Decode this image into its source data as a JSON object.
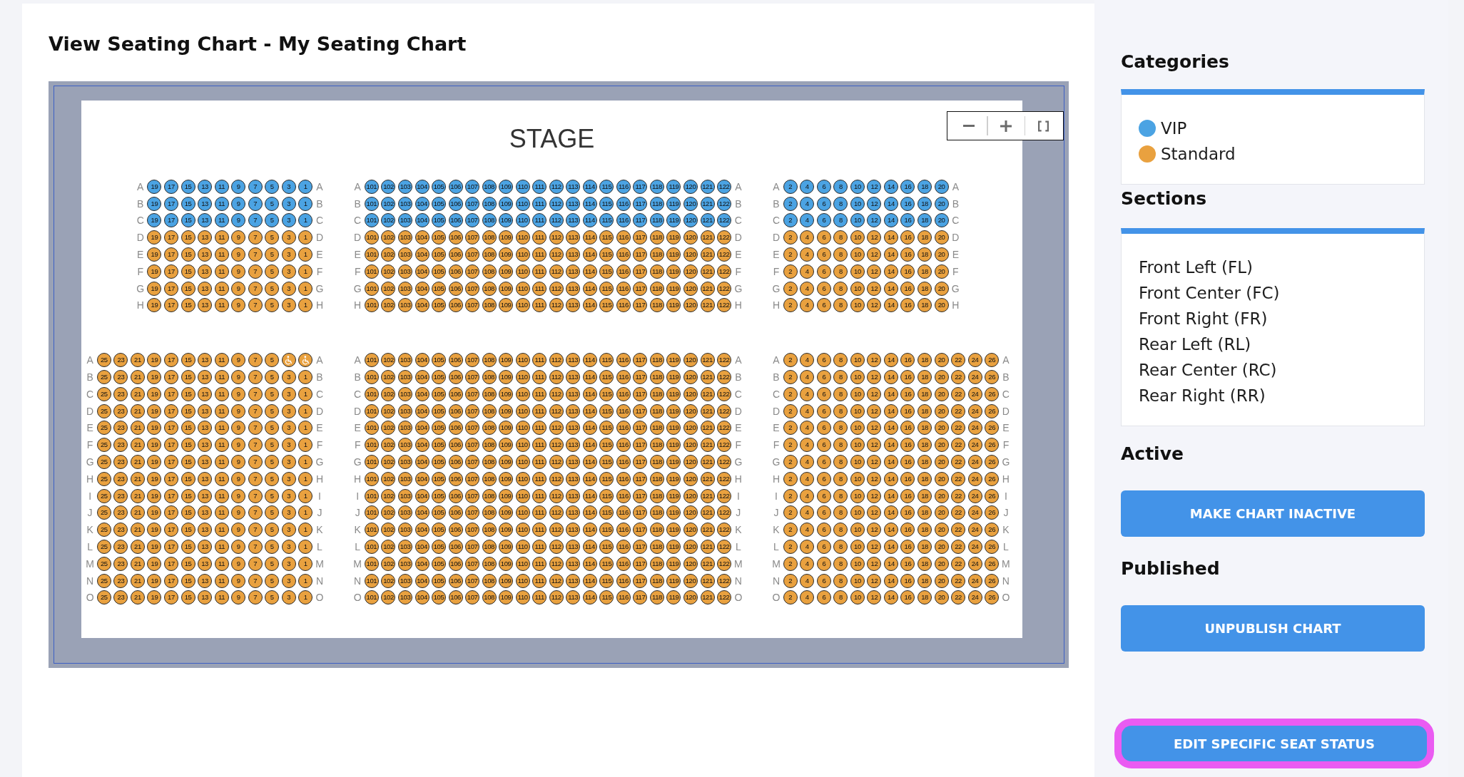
{
  "page": {
    "title": "View Seating Chart - My Seating Chart"
  },
  "chart": {
    "stage_label": "STAGE",
    "zoom_controls": [
      {
        "kind": "zoom_out"
      },
      {
        "kind": "zoom_in"
      },
      {
        "kind": "fit"
      }
    ],
    "blocks": [
      {
        "sections": [
          {
            "rows": [
              {
                "label": "A",
                "end_label": "A",
                "color": "#4ba3e3",
                "seats": [
                  "19",
                  "17",
                  "15",
                  "13",
                  "11",
                  "9",
                  "7",
                  "5",
                  "3",
                  "1"
                ]
              },
              {
                "label": "B",
                "end_label": "B",
                "color": "#4ba3e3",
                "seats": [
                  "19",
                  "17",
                  "15",
                  "13",
                  "11",
                  "9",
                  "7",
                  "5",
                  "3",
                  "1"
                ]
              },
              {
                "label": "C",
                "end_label": "C",
                "color": "#4ba3e3",
                "seats": [
                  "19",
                  "17",
                  "15",
                  "13",
                  "11",
                  "9",
                  "7",
                  "5",
                  "3",
                  "1"
                ]
              },
              {
                "label": "D",
                "end_label": "D",
                "color": "#e9a13f",
                "seats": [
                  "19",
                  "17",
                  "15",
                  "13",
                  "11",
                  "9",
                  "7",
                  "5",
                  "3",
                  "1"
                ]
              },
              {
                "label": "E",
                "end_label": "E",
                "color": "#e9a13f",
                "seats": [
                  "19",
                  "17",
                  "15",
                  "13",
                  "11",
                  "9",
                  "7",
                  "5",
                  "3",
                  "1"
                ]
              },
              {
                "label": "F",
                "end_label": "F",
                "color": "#e9a13f",
                "seats": [
                  "19",
                  "17",
                  "15",
                  "13",
                  "11",
                  "9",
                  "7",
                  "5",
                  "3",
                  "1"
                ]
              },
              {
                "label": "G",
                "end_label": "G",
                "color": "#e9a13f",
                "seats": [
                  "19",
                  "17",
                  "15",
                  "13",
                  "11",
                  "9",
                  "7",
                  "5",
                  "3",
                  "1"
                ]
              },
              {
                "label": "H",
                "end_label": "H",
                "color": "#e9a13f",
                "seats": [
                  "19",
                  "17",
                  "15",
                  "13",
                  "11",
                  "9",
                  "7",
                  "5",
                  "3",
                  "1"
                ]
              }
            ]
          },
          {
            "rows": [
              {
                "label": "A",
                "end_label": "A",
                "color": "#4ba3e3",
                "seats": [
                  "101",
                  "102",
                  "103",
                  "104",
                  "105",
                  "106",
                  "107",
                  "108",
                  "109",
                  "110",
                  "111",
                  "112",
                  "113",
                  "114",
                  "115",
                  "116",
                  "117",
                  "118",
                  "119",
                  "120",
                  "121",
                  "122"
                ]
              },
              {
                "label": "B",
                "end_label": "B",
                "color": "#4ba3e3",
                "seats": [
                  "101",
                  "102",
                  "103",
                  "104",
                  "105",
                  "106",
                  "107",
                  "108",
                  "109",
                  "110",
                  "111",
                  "112",
                  "113",
                  "114",
                  "115",
                  "116",
                  "117",
                  "118",
                  "119",
                  "120",
                  "121",
                  "122"
                ]
              },
              {
                "label": "C",
                "end_label": "C",
                "color": "#4ba3e3",
                "seats": [
                  "101",
                  "102",
                  "103",
                  "104",
                  "105",
                  "106",
                  "107",
                  "108",
                  "109",
                  "110",
                  "111",
                  "112",
                  "113",
                  "114",
                  "115",
                  "116",
                  "117",
                  "118",
                  "119",
                  "120",
                  "121",
                  "122"
                ]
              },
              {
                "label": "D",
                "end_label": "D",
                "color": "#e9a13f",
                "seats": [
                  "101",
                  "102",
                  "103",
                  "104",
                  "105",
                  "106",
                  "107",
                  "108",
                  "109",
                  "110",
                  "111",
                  "112",
                  "113",
                  "114",
                  "115",
                  "116",
                  "117",
                  "118",
                  "119",
                  "120",
                  "121",
                  "122"
                ]
              },
              {
                "label": "E",
                "end_label": "E",
                "color": "#e9a13f",
                "seats": [
                  "101",
                  "102",
                  "103",
                  "104",
                  "105",
                  "106",
                  "107",
                  "108",
                  "109",
                  "110",
                  "111",
                  "112",
                  "113",
                  "114",
                  "115",
                  "116",
                  "117",
                  "118",
                  "119",
                  "120",
                  "121",
                  "122"
                ]
              },
              {
                "label": "F",
                "end_label": "F",
                "color": "#e9a13f",
                "seats": [
                  "101",
                  "102",
                  "103",
                  "104",
                  "105",
                  "106",
                  "107",
                  "108",
                  "109",
                  "110",
                  "111",
                  "112",
                  "113",
                  "114",
                  "115",
                  "116",
                  "117",
                  "118",
                  "119",
                  "120",
                  "121",
                  "122"
                ]
              },
              {
                "label": "G",
                "end_label": "G",
                "color": "#e9a13f",
                "seats": [
                  "101",
                  "102",
                  "103",
                  "104",
                  "105",
                  "106",
                  "107",
                  "108",
                  "109",
                  "110",
                  "111",
                  "112",
                  "113",
                  "114",
                  "115",
                  "116",
                  "117",
                  "118",
                  "119",
                  "120",
                  "121",
                  "122"
                ]
              },
              {
                "label": "H",
                "end_label": "H",
                "color": "#e9a13f",
                "seats": [
                  "101",
                  "102",
                  "103",
                  "104",
                  "105",
                  "106",
                  "107",
                  "108",
                  "109",
                  "110",
                  "111",
                  "112",
                  "113",
                  "114",
                  "115",
                  "116",
                  "117",
                  "118",
                  "119",
                  "120",
                  "121",
                  "122"
                ]
              }
            ]
          },
          {
            "rows": [
              {
                "label": "A",
                "end_label": "A",
                "color": "#4ba3e3",
                "seats": [
                  "2",
                  "4",
                  "6",
                  "8",
                  "10",
                  "12",
                  "14",
                  "16",
                  "18",
                  "20"
                ]
              },
              {
                "label": "B",
                "end_label": "B",
                "color": "#4ba3e3",
                "seats": [
                  "2",
                  "4",
                  "6",
                  "8",
                  "10",
                  "12",
                  "14",
                  "16",
                  "18",
                  "20"
                ]
              },
              {
                "label": "C",
                "end_label": "C",
                "color": "#4ba3e3",
                "seats": [
                  "2",
                  "4",
                  "6",
                  "8",
                  "10",
                  "12",
                  "14",
                  "16",
                  "18",
                  "20"
                ]
              },
              {
                "label": "D",
                "end_label": "D",
                "color": "#e9a13f",
                "seats": [
                  "2",
                  "4",
                  "6",
                  "8",
                  "10",
                  "12",
                  "14",
                  "16",
                  "18",
                  "20"
                ]
              },
              {
                "label": "E",
                "end_label": "E",
                "color": "#e9a13f",
                "seats": [
                  "2",
                  "4",
                  "6",
                  "8",
                  "10",
                  "12",
                  "14",
                  "16",
                  "18",
                  "20"
                ]
              },
              {
                "label": "F",
                "end_label": "F",
                "color": "#e9a13f",
                "seats": [
                  "2",
                  "4",
                  "6",
                  "8",
                  "10",
                  "12",
                  "14",
                  "16",
                  "18",
                  "20"
                ]
              },
              {
                "label": "G",
                "end_label": "G",
                "color": "#e9a13f",
                "seats": [
                  "2",
                  "4",
                  "6",
                  "8",
                  "10",
                  "12",
                  "14",
                  "16",
                  "18",
                  "20"
                ]
              },
              {
                "label": "H",
                "end_label": "H",
                "color": "#e9a13f",
                "seats": [
                  "2",
                  "4",
                  "6",
                  "8",
                  "10",
                  "12",
                  "14",
                  "16",
                  "18",
                  "20"
                ]
              }
            ]
          }
        ]
      },
      {
        "sections": [
          {
            "rows": [
              {
                "label": "A",
                "end_label": "A",
                "color": "#e9a13f",
                "seats": [
                  "25",
                  "23",
                  "21",
                  "19",
                  "17",
                  "15",
                  "13",
                  "11",
                  "9",
                  "7",
                  "5",
                  {
                    "kind": "wheelchair"
                  },
                  {
                    "kind": "wheelchair"
                  }
                ]
              },
              {
                "label": "B",
                "end_label": "B",
                "color": "#e9a13f",
                "seats": [
                  "25",
                  "23",
                  "21",
                  "19",
                  "17",
                  "15",
                  "13",
                  "11",
                  "9",
                  "7",
                  "5",
                  "3",
                  "1"
                ]
              },
              {
                "label": "C",
                "end_label": "C",
                "color": "#e9a13f",
                "seats": [
                  "25",
                  "23",
                  "21",
                  "19",
                  "17",
                  "15",
                  "13",
                  "11",
                  "9",
                  "7",
                  "5",
                  "3",
                  "1"
                ]
              },
              {
                "label": "D",
                "end_label": "D",
                "color": "#e9a13f",
                "seats": [
                  "25",
                  "23",
                  "21",
                  "19",
                  "17",
                  "15",
                  "13",
                  "11",
                  "9",
                  "7",
                  "5",
                  "3",
                  "1"
                ]
              },
              {
                "label": "E",
                "end_label": "E",
                "color": "#e9a13f",
                "seats": [
                  "25",
                  "23",
                  "21",
                  "19",
                  "17",
                  "15",
                  "13",
                  "11",
                  "9",
                  "7",
                  "5",
                  "3",
                  "1"
                ]
              },
              {
                "label": "F",
                "end_label": "F",
                "color": "#e9a13f",
                "seats": [
                  "25",
                  "23",
                  "21",
                  "19",
                  "17",
                  "15",
                  "13",
                  "11",
                  "9",
                  "7",
                  "5",
                  "3",
                  "1"
                ]
              },
              {
                "label": "G",
                "end_label": "G",
                "color": "#e9a13f",
                "seats": [
                  "25",
                  "23",
                  "21",
                  "19",
                  "17",
                  "15",
                  "13",
                  "11",
                  "9",
                  "7",
                  "5",
                  "3",
                  "1"
                ]
              },
              {
                "label": "H",
                "end_label": "H",
                "color": "#e9a13f",
                "seats": [
                  "25",
                  "23",
                  "21",
                  "19",
                  "17",
                  "15",
                  "13",
                  "11",
                  "9",
                  "7",
                  "5",
                  "3",
                  "1"
                ]
              },
              {
                "label": "I",
                "end_label": "I",
                "color": "#e9a13f",
                "seats": [
                  "25",
                  "23",
                  "21",
                  "19",
                  "17",
                  "15",
                  "13",
                  "11",
                  "9",
                  "7",
                  "5",
                  "3",
                  "1"
                ]
              },
              {
                "label": "J",
                "end_label": "J",
                "color": "#e9a13f",
                "seats": [
                  "25",
                  "23",
                  "21",
                  "19",
                  "17",
                  "15",
                  "13",
                  "11",
                  "9",
                  "7",
                  "5",
                  "3",
                  "1"
                ]
              },
              {
                "label": "K",
                "end_label": "K",
                "color": "#e9a13f",
                "seats": [
                  "25",
                  "23",
                  "21",
                  "19",
                  "17",
                  "15",
                  "13",
                  "11",
                  "9",
                  "7",
                  "5",
                  "3",
                  "1"
                ]
              },
              {
                "label": "L",
                "end_label": "L",
                "color": "#e9a13f",
                "seats": [
                  "25",
                  "23",
                  "21",
                  "19",
                  "17",
                  "15",
                  "13",
                  "11",
                  "9",
                  "7",
                  "5",
                  "3",
                  "1"
                ]
              },
              {
                "label": "M",
                "end_label": "M",
                "color": "#e9a13f",
                "seats": [
                  "25",
                  "23",
                  "21",
                  "19",
                  "17",
                  "15",
                  "13",
                  "11",
                  "9",
                  "7",
                  "5",
                  "3",
                  "1"
                ]
              },
              {
                "label": "N",
                "end_label": "N",
                "color": "#e9a13f",
                "seats": [
                  "25",
                  "23",
                  "21",
                  "19",
                  "17",
                  "15",
                  "13",
                  "11",
                  "9",
                  "7",
                  "5",
                  "3",
                  "1"
                ]
              },
              {
                "label": "O",
                "end_label": "O",
                "color": "#e9a13f",
                "seats": [
                  "25",
                  "23",
                  "21",
                  "19",
                  "17",
                  "15",
                  "13",
                  "11",
                  "9",
                  "7",
                  "5",
                  "3",
                  "1"
                ]
              }
            ]
          },
          {
            "rows": [
              {
                "label": "A",
                "end_label": "A",
                "color": "#e9a13f",
                "seats": [
                  "101",
                  "102",
                  "103",
                  "104",
                  "105",
                  "106",
                  "107",
                  "108",
                  "109",
                  "110",
                  "111",
                  "112",
                  "113",
                  "114",
                  "115",
                  "116",
                  "117",
                  "118",
                  "119",
                  "120",
                  "121",
                  "122"
                ]
              },
              {
                "label": "B",
                "end_label": "B",
                "color": "#e9a13f",
                "seats": [
                  "101",
                  "102",
                  "103",
                  "104",
                  "105",
                  "106",
                  "107",
                  "108",
                  "109",
                  "110",
                  "111",
                  "112",
                  "113",
                  "114",
                  "115",
                  "116",
                  "117",
                  "118",
                  "119",
                  "120",
                  "121",
                  "122"
                ]
              },
              {
                "label": "C",
                "end_label": "C",
                "color": "#e9a13f",
                "seats": [
                  "101",
                  "102",
                  "103",
                  "104",
                  "105",
                  "106",
                  "107",
                  "108",
                  "109",
                  "110",
                  "111",
                  "112",
                  "113",
                  "114",
                  "115",
                  "116",
                  "117",
                  "118",
                  "119",
                  "120",
                  "121",
                  "122"
                ]
              },
              {
                "label": "D",
                "end_label": "D",
                "color": "#e9a13f",
                "seats": [
                  "101",
                  "102",
                  "103",
                  "104",
                  "105",
                  "106",
                  "107",
                  "108",
                  "109",
                  "110",
                  "111",
                  "112",
                  "113",
                  "114",
                  "115",
                  "116",
                  "117",
                  "118",
                  "119",
                  "120",
                  "121",
                  "122"
                ]
              },
              {
                "label": "E",
                "end_label": "E",
                "color": "#e9a13f",
                "seats": [
                  "101",
                  "102",
                  "103",
                  "104",
                  "105",
                  "106",
                  "107",
                  "108",
                  "109",
                  "110",
                  "111",
                  "112",
                  "113",
                  "114",
                  "115",
                  "116",
                  "117",
                  "118",
                  "119",
                  "120",
                  "121",
                  "122"
                ]
              },
              {
                "label": "F",
                "end_label": "F",
                "color": "#e9a13f",
                "seats": [
                  "101",
                  "102",
                  "103",
                  "104",
                  "105",
                  "106",
                  "107",
                  "108",
                  "109",
                  "110",
                  "111",
                  "112",
                  "113",
                  "114",
                  "115",
                  "116",
                  "117",
                  "118",
                  "119",
                  "120",
                  "121",
                  "122"
                ]
              },
              {
                "label": "G",
                "end_label": "G",
                "color": "#e9a13f",
                "seats": [
                  "101",
                  "102",
                  "103",
                  "104",
                  "105",
                  "106",
                  "107",
                  "108",
                  "109",
                  "110",
                  "111",
                  "112",
                  "113",
                  "114",
                  "115",
                  "116",
                  "117",
                  "118",
                  "119",
                  "120",
                  "121",
                  "122"
                ]
              },
              {
                "label": "H",
                "end_label": "H",
                "color": "#e9a13f",
                "seats": [
                  "101",
                  "102",
                  "103",
                  "104",
                  "105",
                  "106",
                  "107",
                  "108",
                  "109",
                  "110",
                  "111",
                  "112",
                  "113",
                  "114",
                  "115",
                  "116",
                  "117",
                  "118",
                  "119",
                  "120",
                  "121",
                  "122"
                ]
              },
              {
                "label": "I",
                "end_label": "I",
                "color": "#e9a13f",
                "seats": [
                  "101",
                  "102",
                  "103",
                  "104",
                  "105",
                  "106",
                  "107",
                  "108",
                  "109",
                  "110",
                  "111",
                  "112",
                  "113",
                  "114",
                  "115",
                  "116",
                  "117",
                  "118",
                  "119",
                  "120",
                  "121",
                  "122"
                ]
              },
              {
                "label": "J",
                "end_label": "J",
                "color": "#e9a13f",
                "seats": [
                  "101",
                  "102",
                  "103",
                  "104",
                  "105",
                  "106",
                  "107",
                  "108",
                  "109",
                  "110",
                  "111",
                  "112",
                  "113",
                  "114",
                  "115",
                  "116",
                  "117",
                  "118",
                  "119",
                  "120",
                  "121",
                  "122"
                ]
              },
              {
                "label": "K",
                "end_label": "K",
                "color": "#e9a13f",
                "seats": [
                  "101",
                  "102",
                  "103",
                  "104",
                  "105",
                  "106",
                  "107",
                  "108",
                  "109",
                  "110",
                  "111",
                  "112",
                  "113",
                  "114",
                  "115",
                  "116",
                  "117",
                  "118",
                  "119",
                  "120",
                  "121",
                  "122"
                ]
              },
              {
                "label": "L",
                "end_label": "L",
                "color": "#e9a13f",
                "seats": [
                  "101",
                  "102",
                  "103",
                  "104",
                  "105",
                  "106",
                  "107",
                  "108",
                  "109",
                  "110",
                  "111",
                  "112",
                  "113",
                  "114",
                  "115",
                  "116",
                  "117",
                  "118",
                  "119",
                  "120",
                  "121",
                  "122"
                ]
              },
              {
                "label": "M",
                "end_label": "M",
                "color": "#e9a13f",
                "seats": [
                  "101",
                  "102",
                  "103",
                  "104",
                  "105",
                  "106",
                  "107",
                  "108",
                  "109",
                  "110",
                  "111",
                  "112",
                  "113",
                  "114",
                  "115",
                  "116",
                  "117",
                  "118",
                  "119",
                  "120",
                  "121",
                  "122"
                ]
              },
              {
                "label": "N",
                "end_label": "N",
                "color": "#e9a13f",
                "seats": [
                  "101",
                  "102",
                  "103",
                  "104",
                  "105",
                  "106",
                  "107",
                  "108",
                  "109",
                  "110",
                  "111",
                  "112",
                  "113",
                  "114",
                  "115",
                  "116",
                  "117",
                  "118",
                  "119",
                  "120",
                  "121",
                  "122"
                ]
              },
              {
                "label": "O",
                "end_label": "O",
                "color": "#e9a13f",
                "seats": [
                  "101",
                  "102",
                  "103",
                  "104",
                  "105",
                  "106",
                  "107",
                  "108",
                  "109",
                  "110",
                  "111",
                  "112",
                  "113",
                  "114",
                  "115",
                  "116",
                  "117",
                  "118",
                  "119",
                  "120",
                  "121",
                  "122"
                ]
              }
            ]
          },
          {
            "rows": [
              {
                "label": "A",
                "end_label": "A",
                "color": "#e9a13f",
                "seats": [
                  "2",
                  "4",
                  "6",
                  "8",
                  "10",
                  "12",
                  "14",
                  "16",
                  "18",
                  "20",
                  "22",
                  "24",
                  "26"
                ]
              },
              {
                "label": "B",
                "end_label": "B",
                "color": "#e9a13f",
                "seats": [
                  "2",
                  "4",
                  "6",
                  "8",
                  "10",
                  "12",
                  "14",
                  "16",
                  "18",
                  "20",
                  "22",
                  "24",
                  "26"
                ]
              },
              {
                "label": "C",
                "end_label": "C",
                "color": "#e9a13f",
                "seats": [
                  "2",
                  "4",
                  "6",
                  "8",
                  "10",
                  "12",
                  "14",
                  "16",
                  "18",
                  "20",
                  "22",
                  "24",
                  "26"
                ]
              },
              {
                "label": "D",
                "end_label": "D",
                "color": "#e9a13f",
                "seats": [
                  "2",
                  "4",
                  "6",
                  "8",
                  "10",
                  "12",
                  "14",
                  "16",
                  "18",
                  "20",
                  "22",
                  "24",
                  "26"
                ]
              },
              {
                "label": "E",
                "end_label": "E",
                "color": "#e9a13f",
                "seats": [
                  "2",
                  "4",
                  "6",
                  "8",
                  "10",
                  "12",
                  "14",
                  "16",
                  "18",
                  "20",
                  "22",
                  "24",
                  "26"
                ]
              },
              {
                "label": "F",
                "end_label": "F",
                "color": "#e9a13f",
                "seats": [
                  "2",
                  "4",
                  "6",
                  "8",
                  "10",
                  "12",
                  "14",
                  "16",
                  "18",
                  "20",
                  "22",
                  "24",
                  "26"
                ]
              },
              {
                "label": "G",
                "end_label": "G",
                "color": "#e9a13f",
                "seats": [
                  "2",
                  "4",
                  "6",
                  "8",
                  "10",
                  "12",
                  "14",
                  "16",
                  "18",
                  "20",
                  "22",
                  "24",
                  "26"
                ]
              },
              {
                "label": "H",
                "end_label": "H",
                "color": "#e9a13f",
                "seats": [
                  "2",
                  "4",
                  "6",
                  "8",
                  "10",
                  "12",
                  "14",
                  "16",
                  "18",
                  "20",
                  "22",
                  "24",
                  "26"
                ]
              },
              {
                "label": "I",
                "end_label": "I",
                "color": "#e9a13f",
                "seats": [
                  "2",
                  "4",
                  "6",
                  "8",
                  "10",
                  "12",
                  "14",
                  "16",
                  "18",
                  "20",
                  "22",
                  "24",
                  "26"
                ]
              },
              {
                "label": "J",
                "end_label": "J",
                "color": "#e9a13f",
                "seats": [
                  "2",
                  "4",
                  "6",
                  "8",
                  "10",
                  "12",
                  "14",
                  "16",
                  "18",
                  "20",
                  "22",
                  "24",
                  "26"
                ]
              },
              {
                "label": "K",
                "end_label": "K",
                "color": "#e9a13f",
                "seats": [
                  "2",
                  "4",
                  "6",
                  "8",
                  "10",
                  "12",
                  "14",
                  "16",
                  "18",
                  "20",
                  "22",
                  "24",
                  "26"
                ]
              },
              {
                "label": "L",
                "end_label": "L",
                "color": "#e9a13f",
                "seats": [
                  "2",
                  "4",
                  "6",
                  "8",
                  "10",
                  "12",
                  "14",
                  "16",
                  "18",
                  "20",
                  "22",
                  "24",
                  "26"
                ]
              },
              {
                "label": "M",
                "end_label": "M",
                "color": "#e9a13f",
                "seats": [
                  "2",
                  "4",
                  "6",
                  "8",
                  "10",
                  "12",
                  "14",
                  "16",
                  "18",
                  "20",
                  "22",
                  "24",
                  "26"
                ]
              },
              {
                "label": "N",
                "end_label": "N",
                "color": "#e9a13f",
                "seats": [
                  "2",
                  "4",
                  "6",
                  "8",
                  "10",
                  "12",
                  "14",
                  "16",
                  "18",
                  "20",
                  "22",
                  "24",
                  "26"
                ]
              },
              {
                "label": "O",
                "end_label": "O",
                "color": "#e9a13f",
                "seats": [
                  "2",
                  "4",
                  "6",
                  "8",
                  "10",
                  "12",
                  "14",
                  "16",
                  "18",
                  "20",
                  "22",
                  "24",
                  "26"
                ]
              }
            ]
          }
        ]
      }
    ]
  },
  "sidebar": {
    "groups": [
      {
        "kind": "legend",
        "heading": "Categories",
        "items": [
          {
            "label": "VIP",
            "color": "#4ba3e3"
          },
          {
            "label": "Standard",
            "color": "#e9a13f"
          }
        ]
      },
      {
        "kind": "list",
        "heading": "Sections",
        "items": [
          "Front Left (FL)",
          "Front Center (FC)",
          "Front Right (FR)",
          "Rear Left (RL)",
          "Rear Center (RC)",
          "Rear Right (RR)"
        ]
      },
      {
        "kind": "action",
        "heading": "Active",
        "button": {
          "label": "MAKE CHART INACTIVE",
          "highlighted": false
        }
      },
      {
        "kind": "action",
        "heading": "Published",
        "button": {
          "label": "UNPUBLISH CHART",
          "highlighted": false
        }
      }
    ],
    "bottom_button": {
      "label": "EDIT SPECIFIC SEAT STATUS",
      "highlighted": true
    }
  }
}
